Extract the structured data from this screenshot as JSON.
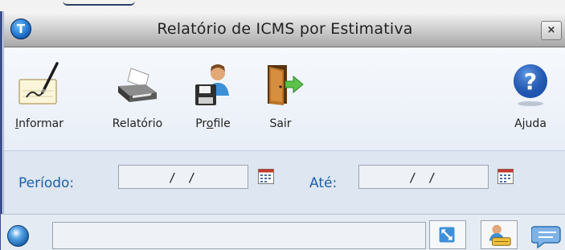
{
  "window": {
    "title": "Relatório de ICMS por Estimativa",
    "logo_glyph": "T",
    "close_glyph": "×"
  },
  "toolbar": {
    "items": [
      {
        "key": "informar",
        "label": "Informar",
        "underline": "I",
        "rest": "nformar",
        "icon": "notepad-pen-icon"
      },
      {
        "key": "relatorio",
        "label": "Relatório",
        "icon": "printer-icon"
      },
      {
        "key": "profile",
        "label": "Profile",
        "underline_index": 2,
        "pre": "Pr",
        "underline": "o",
        "post": "file",
        "icon": "user-disk-icon"
      },
      {
        "key": "sair",
        "label": "Sair",
        "icon": "exit-door-icon"
      },
      {
        "key": "ajuda",
        "label": "Ajuda",
        "icon": "help-question-icon"
      }
    ]
  },
  "form": {
    "periodo_label": "Período:",
    "periodo_value": "/ /",
    "ate_label": "Até:",
    "ate_value": "/ /"
  },
  "statusbar": {
    "field_value": ""
  },
  "colors": {
    "label_blue": "#1f5fa8",
    "toolbar_bg": "#eef3f9",
    "panel_bg": "#dde6f1"
  }
}
